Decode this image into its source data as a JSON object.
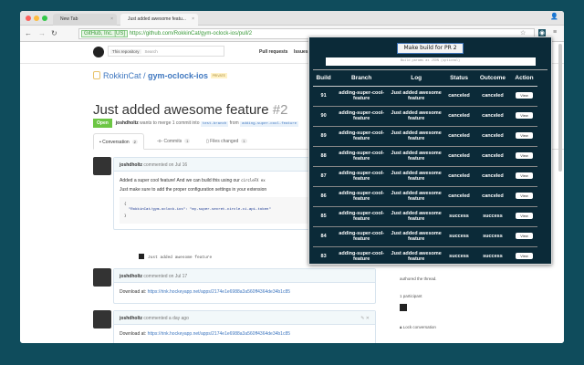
{
  "browser": {
    "tabs": [
      {
        "label": "New Tab"
      },
      {
        "label": "Just added awesome featu..."
      }
    ],
    "secure_label": "GitHub, Inc. [US]",
    "url": "https://github.com/RokkinCat/gym-oclock-ios/pull/2"
  },
  "github": {
    "search_scope": "This repository",
    "search_placeholder": "Search",
    "nav": [
      "Pull requests",
      "Issues"
    ],
    "owner": "RokkinCat",
    "repo": "gym-oclock-ios",
    "private_label": "PRIVATE",
    "pr": {
      "title": "Just added awesome feature",
      "number": "#2",
      "state": "Open",
      "author": "joshdholtz",
      "meta_text": "wants to merge 1 commit into",
      "base": "test-branch",
      "from": "from",
      "head": "adding-super-cool-feature"
    },
    "tabs": [
      {
        "label": "Conversation",
        "count": "2"
      },
      {
        "label": "Commits",
        "count": "1"
      },
      {
        "label": "Files changed",
        "count": "1"
      }
    ],
    "comments": [
      {
        "author": "joshdholtz",
        "when": "commented on Jul 16",
        "line1": "Added a super cool feature! And we can build this using our",
        "inline_code": "circleFX ex",
        "line2": "Just make sure to add the proper configuration settings in your extension",
        "code_key": "\"RokkinCat/gym-oclock-ios\":",
        "code_val": "\"my-super-secret-circle-ci-api-token\""
      },
      {
        "author": "joshdholtz",
        "when": "commented on Jul 17",
        "text": "Download at:",
        "link": "https://rink.hockeyapp.net/apps/2174e1e6988a3a560ff4364de34b1c85"
      },
      {
        "author": "joshdholtz",
        "when": "commented a day ago",
        "text": "Download at:",
        "link": "https://rink.hockeyapp.net/apps/2174e1e6988a3a560ff4364de34b1c85"
      }
    ],
    "commit": "Just added awesome feature",
    "sidebar": {
      "authored": "authored the thread.",
      "participants": "1 participant",
      "lock": "Lock conversation"
    }
  },
  "popup": {
    "make_build": "Make build for PR 2",
    "params_placeholder": "Build params as JSON (optional)",
    "columns": [
      "Build",
      "Branch",
      "Log",
      "Status",
      "Outcome",
      "Action"
    ],
    "rows": [
      {
        "build": "91",
        "branch": "adding-super-cool-feature",
        "log": "Just added awesome feature",
        "status": "canceled",
        "outcome": "canceled",
        "action": "View"
      },
      {
        "build": "90",
        "branch": "adding-super-cool-feature",
        "log": "Just added awesome feature",
        "status": "canceled",
        "outcome": "canceled",
        "action": "View"
      },
      {
        "build": "89",
        "branch": "adding-super-cool-feature",
        "log": "Just added awesome feature",
        "status": "canceled",
        "outcome": "canceled",
        "action": "View"
      },
      {
        "build": "88",
        "branch": "adding-super-cool-feature",
        "log": "Just added awesome feature",
        "status": "canceled",
        "outcome": "canceled",
        "action": "View"
      },
      {
        "build": "87",
        "branch": "adding-super-cool-feature",
        "log": "Just added awesome feature",
        "status": "canceled",
        "outcome": "canceled",
        "action": "View"
      },
      {
        "build": "86",
        "branch": "adding-super-cool-feature",
        "log": "Just added awesome feature",
        "status": "canceled",
        "outcome": "canceled",
        "action": "View"
      },
      {
        "build": "85",
        "branch": "adding-super-cool-feature",
        "log": "Just added awesome feature",
        "status": "success",
        "outcome": "success",
        "action": "View"
      },
      {
        "build": "84",
        "branch": "adding-super-cool-feature",
        "log": "Just added awesome feature",
        "status": "success",
        "outcome": "success",
        "action": "View"
      },
      {
        "build": "83",
        "branch": "adding-super-cool-feature",
        "log": "Just added awesome feature",
        "status": "success",
        "outcome": "success",
        "action": "View"
      }
    ]
  }
}
